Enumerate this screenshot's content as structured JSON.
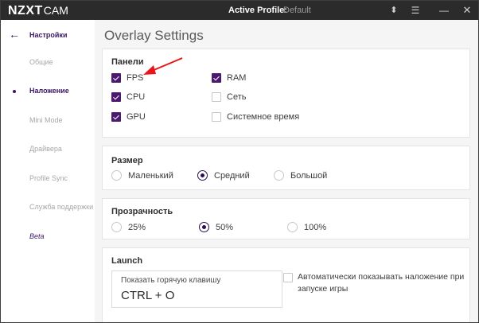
{
  "titlebar": {
    "logo_main": "NZXT",
    "logo_sub": "CAM",
    "profile_label": "Active Profile:",
    "profile_value": "Default",
    "sort_icon_glyph": "⬍",
    "list_icon_glyph": "☰",
    "minimize_glyph": "—",
    "close_glyph": "✕"
  },
  "sidebar": {
    "back_glyph": "←",
    "title": "Настройки",
    "items": [
      {
        "label": "Общие"
      },
      {
        "label": "Наложение"
      },
      {
        "label": "Mini Mode"
      },
      {
        "label": "Драйвера"
      },
      {
        "label": "Profile Sync"
      },
      {
        "label": "Служба поддержки"
      },
      {
        "label": "Beta"
      }
    ]
  },
  "main": {
    "title": "Overlay Settings",
    "panels": {
      "title": "Панели",
      "items": [
        {
          "label": "FPS",
          "checked": true
        },
        {
          "label": "CPU",
          "checked": true
        },
        {
          "label": "GPU",
          "checked": true
        },
        {
          "label": "RAM",
          "checked": true
        },
        {
          "label": "Сеть",
          "checked": false
        },
        {
          "label": "Системное время",
          "checked": false
        }
      ]
    },
    "size": {
      "title": "Размер",
      "options": [
        {
          "label": "Маленький",
          "selected": false
        },
        {
          "label": "Средний",
          "selected": true
        },
        {
          "label": "Большой",
          "selected": false
        }
      ]
    },
    "opacity": {
      "title": "Прозрачность",
      "options": [
        {
          "label": "25%",
          "selected": false
        },
        {
          "label": "50%",
          "selected": true
        },
        {
          "label": "100%",
          "selected": false
        }
      ]
    },
    "launch": {
      "title": "Launch",
      "hotkey_label": "Показать горячую клавишу",
      "hotkey_value": "CTRL + O",
      "auto_show_label": "Автоматически показывать наложение при запуске игры",
      "auto_show_checked": false
    }
  },
  "colors": {
    "accent": "#4b1a6e",
    "titlebar_bg": "#2b2b2b",
    "annotation_arrow": "#e8161b"
  }
}
